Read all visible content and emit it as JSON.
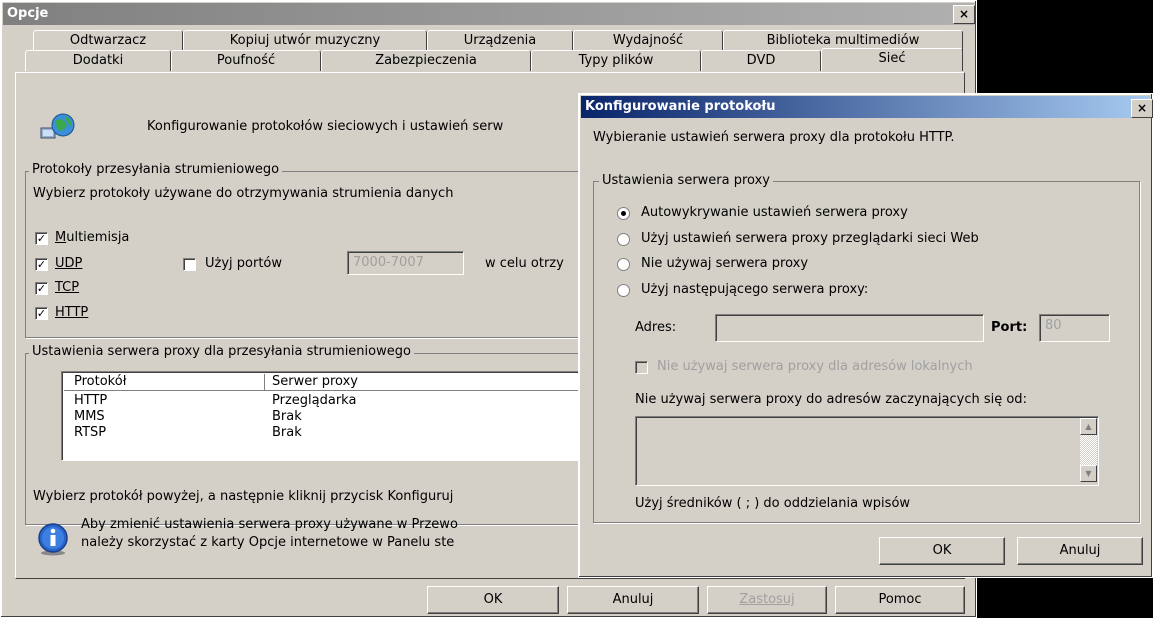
{
  "main_window": {
    "title": "Opcje",
    "close_label": "×",
    "tabs_row1": [
      "Odtwarzacz",
      "Kopiuj utwór muzyczny",
      "Urządzenia",
      "Wydajność",
      "Biblioteka multimediów"
    ],
    "tabs_row2": [
      "Dodatki",
      "Poufność",
      "Zabezpieczenia",
      "Typy plików",
      "DVD",
      "Sieć"
    ],
    "header_text": "Konfigurowanie protokołów sieciowych i ustawień serw",
    "protocols_group": {
      "title": "Protokoły przesyłania strumieniowego",
      "description": "Wybierz protokoły używane do otrzymywania strumienia danych",
      "multicast": {
        "label": "Multiemisja",
        "checked": true
      },
      "udp": {
        "label": "UDP",
        "checked": true
      },
      "use_ports": {
        "label": "Użyj portów",
        "checked": false
      },
      "ports_value": "7000-7007",
      "ports_suffix": "w celu otrzy",
      "tcp": {
        "label": "TCP",
        "checked": true
      },
      "http": {
        "label": "HTTP",
        "checked": true
      }
    },
    "proxy_group": {
      "title": "Ustawienia serwera proxy dla przesyłania strumieniowego",
      "columns": [
        "Protokół",
        "Serwer proxy"
      ],
      "rows": [
        {
          "protocol": "HTTP",
          "proxy": "Przeglądarka"
        },
        {
          "protocol": "MMS",
          "proxy": "Brak"
        },
        {
          "protocol": "RTSP",
          "proxy": "Brak"
        }
      ],
      "footer": "Wybierz protokół powyżej, a następnie kliknij przycisk Konfiguruj"
    },
    "info_line1": "Aby zmienić ustawienia serwera proxy używane w Przewo",
    "info_line2": "należy skorzystać z karty Opcje internetowe w Panelu ste",
    "buttons": {
      "ok": "OK",
      "cancel": "Anuluj",
      "apply": "Zastosuj",
      "help": "Pomoc"
    }
  },
  "dialog": {
    "title": "Konfigurowanie protokołu",
    "close_label": "×",
    "description": "Wybieranie ustawień serwera proxy dla protokołu HTTP.",
    "group_title": "Ustawienia serwera proxy",
    "radio_options": [
      "Autowykrywanie ustawień serwera proxy",
      "Użyj ustawień serwera proxy przeglądarki sieci Web",
      "Nie używaj serwera proxy",
      "Użyj następującego serwera proxy:"
    ],
    "selected_index": 0,
    "address_label": "Adres:",
    "address_value": "",
    "port_label": "Port:",
    "port_value": "80",
    "bypass_local_label": "Nie używaj serwera proxy dla adresów lokalnych",
    "bypass_list_label": "Nie używaj serwera proxy do adresów zaczynających się od:",
    "separator_hint": "Użyj średników ( ; ) do oddzielania wpisów",
    "ok": "OK",
    "cancel": "Anuluj"
  },
  "colors": {
    "titlebar_inactive": "#808080",
    "titlebar_active": "#0a246a",
    "window_face": "#d4d0c8"
  }
}
